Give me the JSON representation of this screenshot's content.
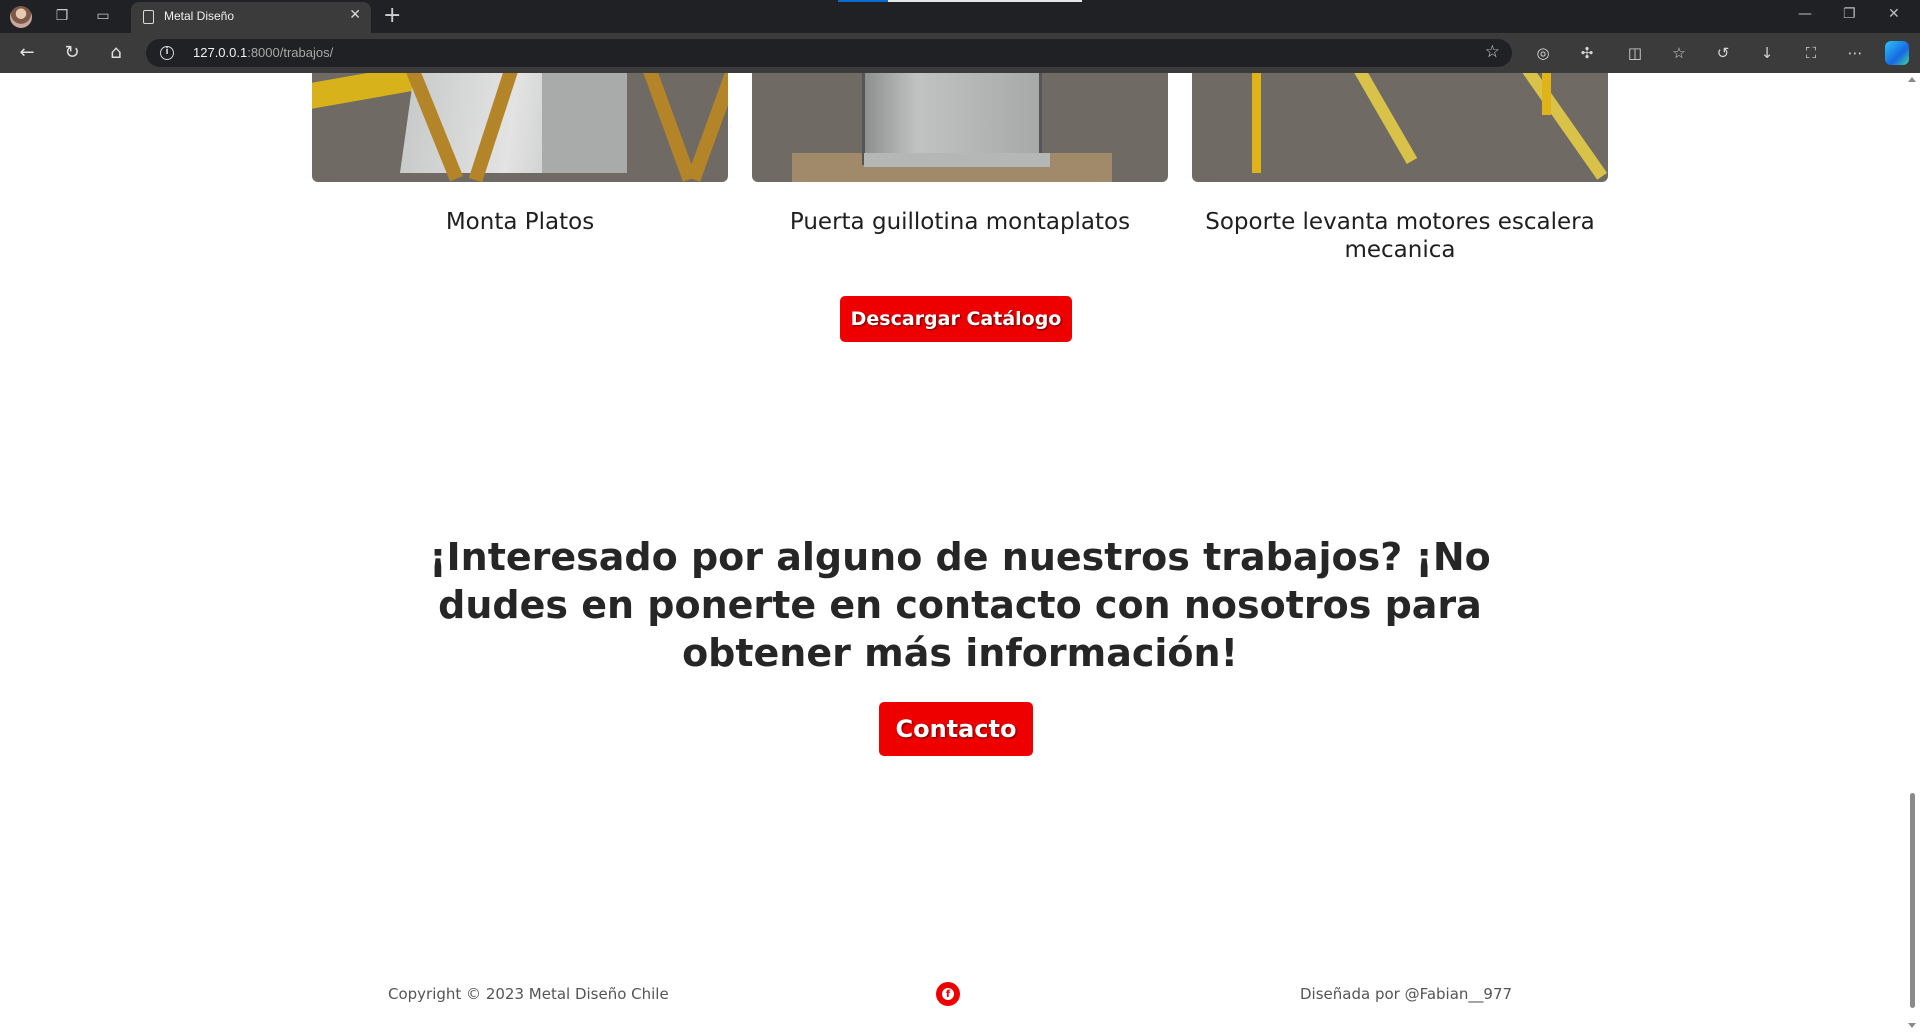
{
  "browser": {
    "tab_title": "Metal Diseño",
    "url_host": "127.0.0.1",
    "url_rest": ":8000/trabajos/"
  },
  "works": [
    {
      "caption": "Monta Platos"
    },
    {
      "caption": "Puerta guillotina montaplatos"
    },
    {
      "caption": "Soporte levanta motores escalera mecanica"
    }
  ],
  "catalog_button": "Descargar Catálogo",
  "cta": {
    "heading": "¡Interesado por alguno de nuestros trabajos? ¡No dudes en ponerte en contacto con nosotros para obtener más información!",
    "button": "Contacto"
  },
  "footer": {
    "copyright": "Copyright © 2023 Metal Diseño Chile",
    "designed_by": "Diseñada por @Fabian__977",
    "social_icon": "facebook-icon"
  },
  "colors": {
    "accent": "#ee0000",
    "browser_dark": "#202124",
    "browser_toolbar": "#3b3b3b"
  }
}
